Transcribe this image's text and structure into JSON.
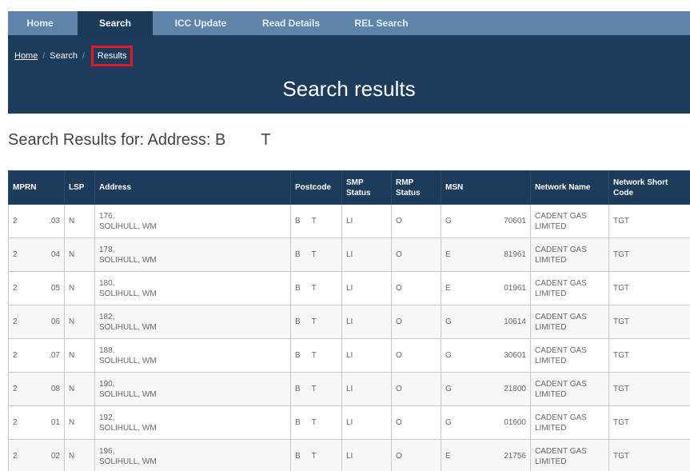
{
  "nav": {
    "items": [
      {
        "label": "Home",
        "active": false
      },
      {
        "label": "Search",
        "active": true
      },
      {
        "label": "ICC Update",
        "active": false
      },
      {
        "label": "Read Details",
        "active": false
      },
      {
        "label": "REL Search",
        "active": false
      }
    ]
  },
  "breadcrumb": {
    "home": "Home",
    "search": "Search",
    "current": "Results"
  },
  "banner": {
    "title": "Search results"
  },
  "results_heading": "Search Results for: Address: B        T",
  "colors": {
    "nav_bg": "#5e84aa",
    "banner_bg": "#1d3c5b",
    "highlight": "#e01a22"
  },
  "table": {
    "headers": [
      "MPRN",
      "LSP",
      "Address",
      "Postcode",
      "SMP Status",
      "RMP Status",
      "MSN",
      "Network Name",
      "Network Short Code"
    ],
    "rows": [
      {
        "mprn_a": "2",
        "mprn_b": ".03",
        "lsp": "N",
        "addr1": "176,",
        "addr2": "SOLIHULL, WM",
        "pc_a": "B",
        "pc_b": "T",
        "smp": "LI",
        "rmp": "O",
        "msn_a": "G",
        "msn_b": "70601",
        "network": "CADENT GAS LIMITED",
        "code": "TGT"
      },
      {
        "mprn_a": "2",
        "mprn_b": "04",
        "lsp": "N",
        "addr1": "178,",
        "addr2": "SOLIHULL, WM",
        "pc_a": "B",
        "pc_b": "T",
        "smp": "LI",
        "rmp": "O",
        "msn_a": "E",
        "msn_b": "81961",
        "network": "CADENT GAS LIMITED",
        "code": "TGT"
      },
      {
        "mprn_a": "2",
        "mprn_b": "05",
        "lsp": "N",
        "addr1": "180,",
        "addr2": "SOLIHULL, WM",
        "pc_a": "B",
        "pc_b": "T",
        "smp": "LI",
        "rmp": "O",
        "msn_a": "E",
        "msn_b": "01961",
        "network": "CADENT GAS LIMITED",
        "code": "TGT"
      },
      {
        "mprn_a": "2",
        "mprn_b": "06",
        "lsp": "N",
        "addr1": "182,",
        "addr2": "SOLIHULL, WM",
        "pc_a": "B",
        "pc_b": "T",
        "smp": "LI",
        "rmp": "O",
        "msn_a": "G",
        "msn_b": "10614",
        "network": "CADENT GAS LIMITED",
        "code": "TGT"
      },
      {
        "mprn_a": "2",
        "mprn_b": ".07",
        "lsp": "N",
        "addr1": "188,",
        "addr2": "SOLIHULL, WM",
        "pc_a": "B",
        "pc_b": "T",
        "smp": "LI",
        "rmp": "O",
        "msn_a": "G",
        "msn_b": "30601",
        "network": "CADENT GAS LIMITED",
        "code": "TGT"
      },
      {
        "mprn_a": "2",
        "mprn_b": "08",
        "lsp": "N",
        "addr1": "190,",
        "addr2": "SOLIHULL, WM",
        "pc_a": "B",
        "pc_b": "T",
        "smp": "LI",
        "rmp": "O",
        "msn_a": "G",
        "msn_b": "21800",
        "network": "CADENT GAS LIMITED",
        "code": "TGT"
      },
      {
        "mprn_a": "2",
        "mprn_b": "01",
        "lsp": "N",
        "addr1": "192,",
        "addr2": "SOLIHULL, WM",
        "pc_a": "B",
        "pc_b": "T",
        "smp": "LI",
        "rmp": "O",
        "msn_a": "G",
        "msn_b": "01600",
        "network": "CADENT GAS LIMITED",
        "code": "TGT"
      },
      {
        "mprn_a": "2",
        "mprn_b": "02",
        "lsp": "N",
        "addr1": "196,",
        "addr2": "SOLIHULL, WM",
        "pc_a": "B",
        "pc_b": "T",
        "smp": "LI",
        "rmp": "O",
        "msn_a": "E",
        "msn_b": "21756",
        "network": "CADENT GAS LIMITED",
        "code": "TGT"
      }
    ]
  }
}
